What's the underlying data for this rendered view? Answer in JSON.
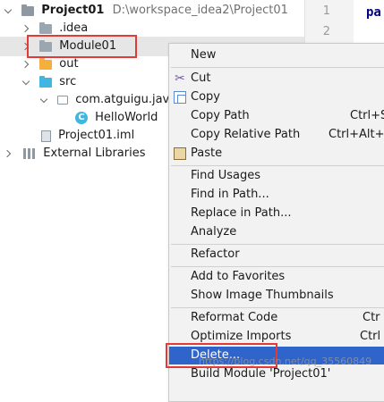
{
  "tree": {
    "project": {
      "name": "Project01",
      "path": "D:\\workspace_idea2\\Project01"
    },
    "items": [
      {
        "label": ".idea"
      },
      {
        "label": "Module01"
      },
      {
        "label": "out"
      },
      {
        "label": "src"
      },
      {
        "label": "com.atguigu.java"
      },
      {
        "label": "HelloWorld"
      },
      {
        "label": "Project01.iml"
      },
      {
        "label": "External Libraries"
      }
    ]
  },
  "editor": {
    "line_numbers": [
      "1",
      "2"
    ],
    "code_fragment": "pa"
  },
  "menu": {
    "new": "New",
    "cut": "Cut",
    "copy": "Copy",
    "copy_path": "Copy Path",
    "copy_path_sc": "Ctrl+S",
    "copy_relative_path": "Copy Relative Path",
    "copy_relative_path_sc": "Ctrl+Alt+S",
    "paste": "Paste",
    "find_usages": "Find Usages",
    "find_in_path": "Find in Path...",
    "replace_in_path": "Replace in Path...",
    "analyze": "Analyze",
    "refactor": "Refactor",
    "add_to_favorites": "Add to Favorites",
    "show_image_thumbnails": "Show Image Thumbnails",
    "reformat_code": "Reformat Code",
    "reformat_code_sc": "Ctr",
    "optimize_imports": "Optimize Imports",
    "optimize_imports_sc": "Ctrl",
    "delete": "Delete...",
    "build_module": "Build Module 'Project01'"
  },
  "watermark": "https://blog.csdn.net/qq_35560849",
  "colors": {
    "selection": "#2f65ca",
    "highlight_box": "#e53935",
    "class_icon": "#40b6e0",
    "folder_orange": "#f4af3d"
  }
}
